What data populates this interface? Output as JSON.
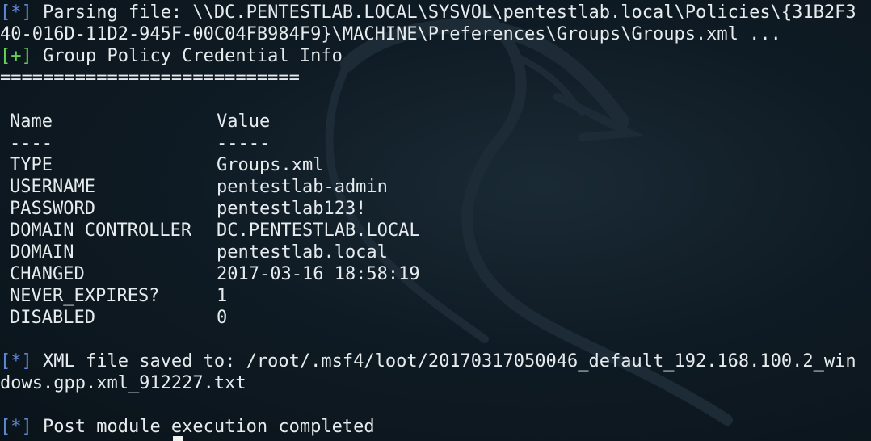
{
  "terminal": {
    "line1": {
      "tag": "[*]",
      "text": " Parsing file: \\\\DC.PENTESTLAB.LOCAL\\SYSVOL\\pentestlab.local\\Policies\\{31B2F3"
    },
    "line2": {
      "text": "40-016D-11D2-945F-00C04FB984F9}\\MACHINE\\Preferences\\Groups\\Groups.xml ..."
    },
    "line3": {
      "tag": "[+]",
      "text": " Group Policy Credential Info"
    },
    "separator": "============================",
    "table": {
      "headers": {
        "name": "Name",
        "value": "Value"
      },
      "header_underlines": {
        "name": "----",
        "value": "-----"
      },
      "rows": [
        {
          "name": "TYPE",
          "value": "Groups.xml"
        },
        {
          "name": "USERNAME",
          "value": "pentestlab-admin"
        },
        {
          "name": "PASSWORD",
          "value": "pentestlab123!"
        },
        {
          "name": "DOMAIN CONTROLLER",
          "value": "DC.PENTESTLAB.LOCAL"
        },
        {
          "name": "DOMAIN",
          "value": "pentestlab.local"
        },
        {
          "name": "CHANGED",
          "value": "2017-03-16 18:58:19"
        },
        {
          "name": "NEVER_EXPIRES?",
          "value": "1"
        },
        {
          "name": "DISABLED",
          "value": "0"
        }
      ]
    },
    "line_saved": {
      "tag": "[*]",
      "text": " XML file saved to: /root/.msf4/loot/20170317050046_default_192.168.100.2_win"
    },
    "line_saved2": {
      "text": "dows.gpp.xml_912227.txt"
    },
    "line_done": {
      "tag": "[*]",
      "text": " Post module execution completed"
    }
  },
  "colors": {
    "info_tag": "#5f87d6",
    "success_tag": "#63d155",
    "text": "#e6ebee",
    "background": "#0f1b24"
  },
  "icons": {
    "background": "kali-dragon-watermark"
  }
}
